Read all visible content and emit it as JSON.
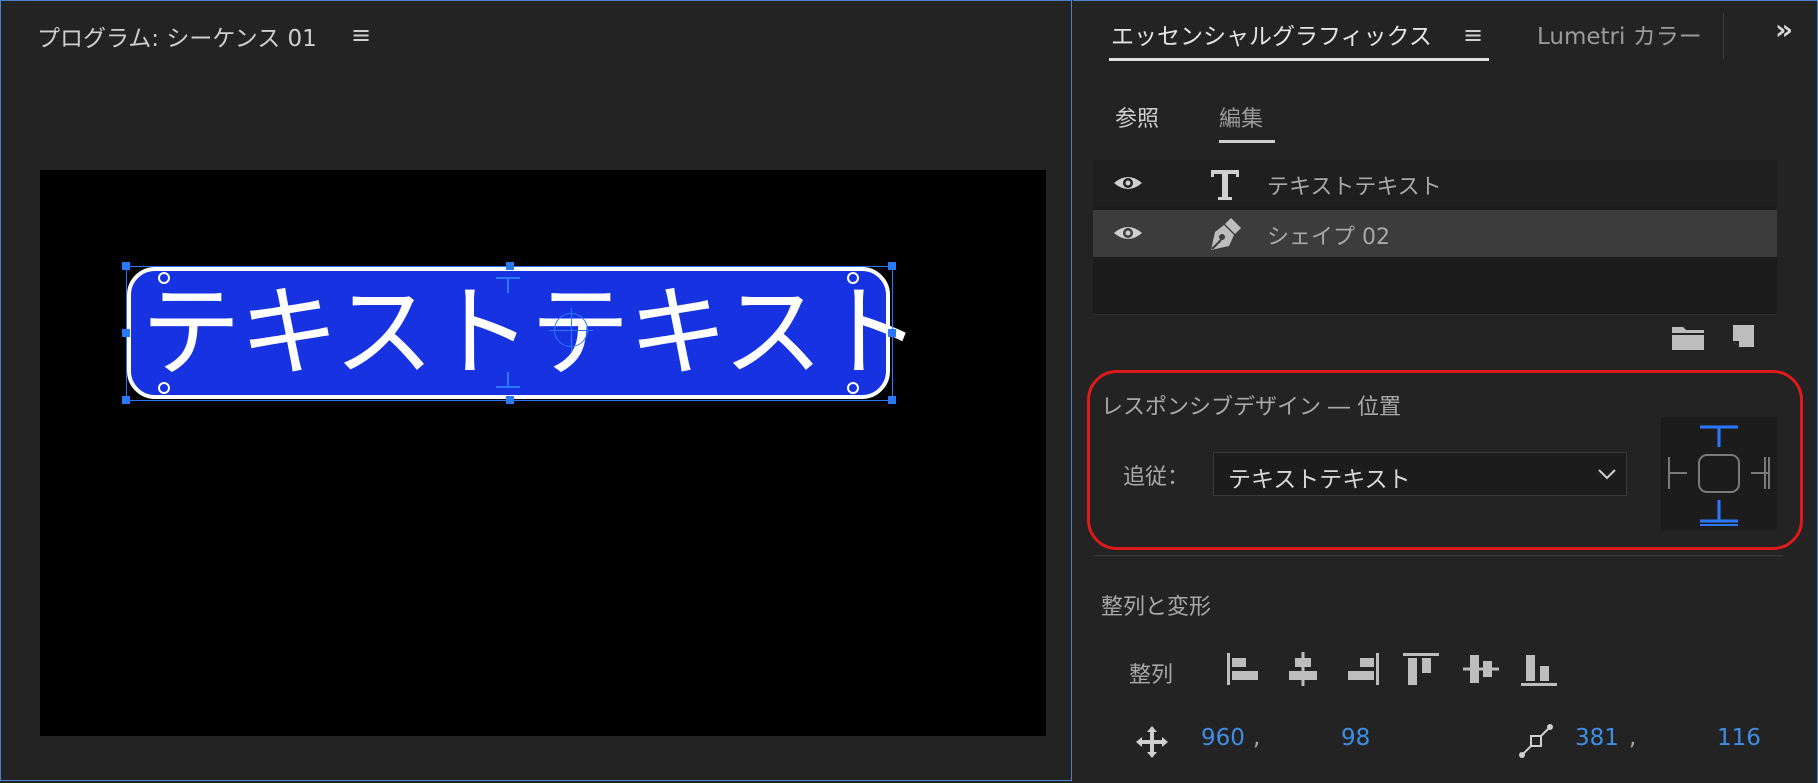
{
  "program_monitor": {
    "title": "プログラム: シーケンス 01",
    "menu_icon": "hamburger-menu-icon",
    "canvas_text": "テキストテキスト",
    "shape_fill": "#1732e0",
    "selection_color": "#2a78ff"
  },
  "right_panel": {
    "tabs": [
      {
        "label": "エッセンシャルグラフィックス",
        "active": true
      },
      {
        "label": "Lumetri カラー",
        "active": false
      }
    ],
    "overflow_icon": "double-chevron-right-icon",
    "subtabs": [
      {
        "label": "参照",
        "active": false
      },
      {
        "label": "編集",
        "active": true
      }
    ],
    "layers": [
      {
        "name": "テキストテキスト",
        "type_icon": "text-t-icon",
        "visible": true,
        "selected": false
      },
      {
        "name": "シェイプ 02",
        "type_icon": "pen-icon",
        "visible": true,
        "selected": true
      }
    ],
    "footer_icons": [
      "folder-icon",
      "new-layer-icon"
    ],
    "responsive": {
      "title": "レスポンシブデザイン ― 位置",
      "follow_label": "追従：",
      "follow_value": "テキストテキスト",
      "highlight_color": "#e01a1a"
    },
    "align": {
      "section_title": "整列と変形",
      "align_label": "整列",
      "buttons": [
        "align-left-icon",
        "align-center-horizontal-icon",
        "align-right-icon",
        "align-top-icon",
        "align-center-vertical-icon",
        "align-bottom-icon"
      ],
      "position": {
        "x": "960",
        "y": "98"
      },
      "anchor": {
        "x": "381",
        "y": "116"
      },
      "value_color": "#3d8ee6"
    }
  }
}
